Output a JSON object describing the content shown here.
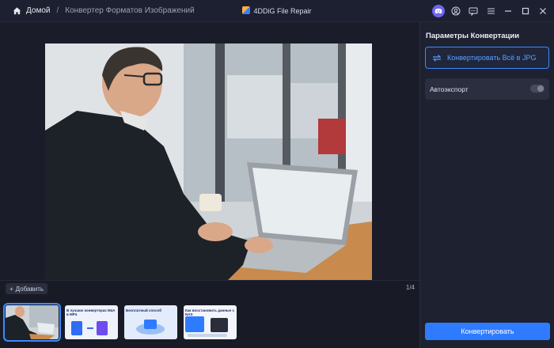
{
  "app": {
    "title": "4DDiG File Repair"
  },
  "breadcrumb": {
    "home": "Домой",
    "separator": "/",
    "current": "Конвертер Форматов Изображений"
  },
  "window_icons": [
    "discord-icon",
    "account-icon",
    "feedback-icon",
    "menu-icon",
    "minimize-icon",
    "maximize-icon",
    "close-icon"
  ],
  "bottom": {
    "add_label": "Добавить",
    "counter": "1/4",
    "thumbnails": [
      {
        "name": "photo-man-laptop",
        "active": true
      },
      {
        "name": "m4a-to-mp4-banner",
        "caption": "В лучших конвертерах M4A в MP4",
        "active": false
      },
      {
        "name": "blue-banner",
        "caption": "Бесплатный способ",
        "active": false
      },
      {
        "name": "nas-banner",
        "caption": "Как восстановить данные с NAS",
        "active": false
      }
    ]
  },
  "panel": {
    "title": "Параметры Конвертации",
    "convert_all": "Конвертировать Всё в JPG",
    "autoexport": "Автоэкспорт",
    "autoexport_enabled": false,
    "convert_button": "Конвертировать"
  },
  "colors": {
    "accent": "#2f7bff",
    "background": "#181b26",
    "panel": "#1e2130"
  }
}
